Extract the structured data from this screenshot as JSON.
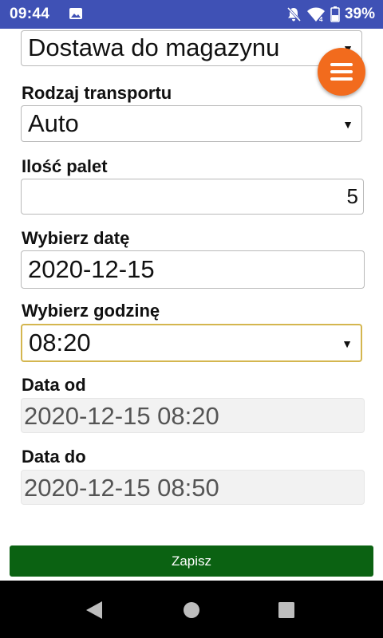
{
  "status_bar": {
    "time": "09:44",
    "battery": "39%",
    "icons": [
      "gallery-icon",
      "mute-bell-icon",
      "wifi-icon",
      "battery-icon"
    ]
  },
  "form": {
    "delivery_type_value": "Dostawa do magazynu",
    "transport": {
      "label": "Rodzaj transportu",
      "value": "Auto"
    },
    "pallets": {
      "label": "Ilość palet",
      "value": "5"
    },
    "date": {
      "label": "Wybierz datę",
      "value": "2020-12-15"
    },
    "hour": {
      "label": "Wybierz godzinę",
      "value": "08:20"
    },
    "date_from": {
      "label": "Data od",
      "value": "2020-12-15 08:20"
    },
    "date_to": {
      "label": "Data do",
      "value": "2020-12-15 08:50"
    },
    "save_label": "Zapisz"
  },
  "colors": {
    "status_bar": "#3f51b5",
    "fab": "#f26b1d",
    "save_button": "#0b6212",
    "focus_border": "#d4b64f"
  },
  "icons": {
    "menu": "hamburger-icon",
    "dropdown": "caret-down-icon",
    "nav": [
      "back-icon",
      "home-icon",
      "recents-icon"
    ]
  }
}
